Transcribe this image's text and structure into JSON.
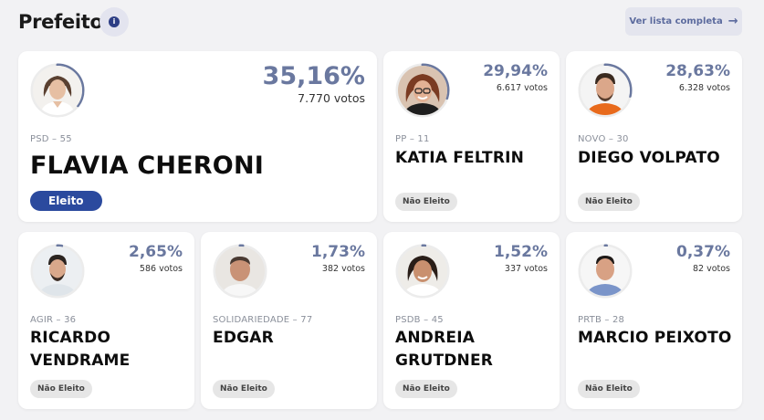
{
  "header": {
    "title": "Prefeito",
    "info_icon": "info-icon",
    "list_button": "Ver lista completa",
    "arrow_glyph": "→"
  },
  "accent_color": "#2b4a9e",
  "candidates": [
    {
      "name": "FLAVIA CHERONI",
      "party": "PSD – 55",
      "percent": "35,16%",
      "votes": "7.770 votos",
      "status": "Eleito"
    },
    {
      "name": "KATIA FELTRIN",
      "party": "PP – 11",
      "percent": "29,94%",
      "votes": "6.617 votos",
      "status": "Não Eleito"
    },
    {
      "name": "DIEGO VOLPATO",
      "party": "NOVO – 30",
      "percent": "28,63%",
      "votes": "6.328 votos",
      "status": "Não Eleito"
    },
    {
      "name": "RICARDO VENDRAME",
      "party": "AGIR – 36",
      "percent": "2,65%",
      "votes": "586 votos",
      "status": "Não Eleito"
    },
    {
      "name": "EDGAR",
      "party": "SOLIDARIEDADE – 77",
      "percent": "1,73%",
      "votes": "382 votos",
      "status": "Não Eleito"
    },
    {
      "name": "ANDREIA GRUTDNER",
      "party": "PSDB – 45",
      "percent": "1,52%",
      "votes": "337 votos",
      "status": "Não Eleito"
    },
    {
      "name": "MARCIO PEIXOTO",
      "party": "PRTB – 28",
      "percent": "0,37%",
      "votes": "82 votos",
      "status": "Não Eleito"
    }
  ],
  "vote_share": [
    0.3516,
    0.2994,
    0.2863,
    0.0265,
    0.0173,
    0.0152,
    0.0037
  ]
}
